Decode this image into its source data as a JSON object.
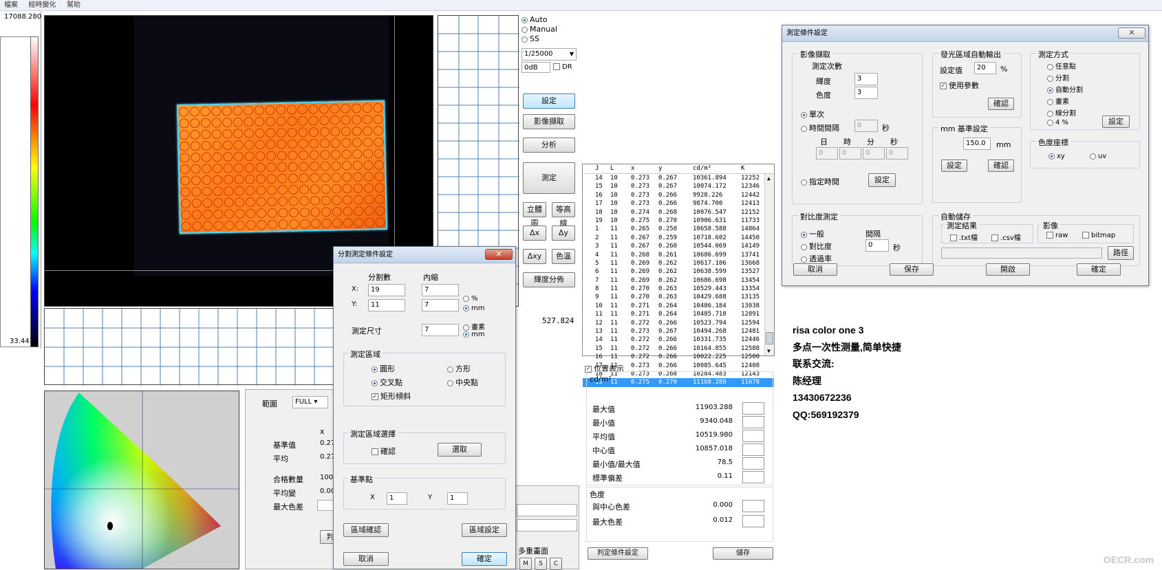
{
  "menu": [
    "檔案",
    "經時變化",
    "幫助"
  ],
  "colorbar": {
    "max": "17088.280",
    "min": "33.441"
  },
  "mode": {
    "auto": "Auto",
    "manual": "Manual",
    "ss": "SS",
    "shutter": "1/25000",
    "gain": "0dB",
    "dr": "DR"
  },
  "buttons": {
    "setting": "設定",
    "capture": "影像擷取",
    "analyze": "分析",
    "measure": "測定",
    "stereo": "立體圖",
    "contour": "等高線",
    "dx": "Δx",
    "dy": "Δy",
    "dxy": "Δxy",
    "color": "色溫",
    "lum_dist": "輝度分佈",
    "judge": "判定條件設定",
    "save": "儲存",
    "multi": "多重畫面",
    "m": "M",
    "s": "S",
    "c": "C"
  },
  "readout": "527.824",
  "list": {
    "headers": [
      "J",
      "L",
      "x",
      "y",
      "cd/m²",
      "K"
    ],
    "rows": [
      [
        "14",
        "10",
        "0.273",
        "0.267",
        "10361.894",
        "12252"
      ],
      [
        "15",
        "10",
        "0.273",
        "0.267",
        "10074.172",
        "12346"
      ],
      [
        "16",
        "10",
        "0.273",
        "0.266",
        "9928.226",
        "12442"
      ],
      [
        "17",
        "10",
        "0.273",
        "0.266",
        "9874.700",
        "12413"
      ],
      [
        "18",
        "10",
        "0.274",
        "0.268",
        "10076.547",
        "12152"
      ],
      [
        "19",
        "10",
        "0.275",
        "0.270",
        "10906.631",
        "11733"
      ],
      [
        "1",
        "11",
        "0.265",
        "0.258",
        "10658.588",
        "14864"
      ],
      [
        "2",
        "11",
        "0.267",
        "0.259",
        "10718.602",
        "14450"
      ],
      [
        "3",
        "11",
        "0.267",
        "0.260",
        "10544.069",
        "14149"
      ],
      [
        "4",
        "11",
        "0.268",
        "0.261",
        "10686.699",
        "13741"
      ],
      [
        "5",
        "11",
        "0.269",
        "0.262",
        "10617.106",
        "13668"
      ],
      [
        "6",
        "11",
        "0.269",
        "0.262",
        "10638.599",
        "13527"
      ],
      [
        "7",
        "11",
        "0.269",
        "0.262",
        "10686.698",
        "13454"
      ],
      [
        "8",
        "11",
        "0.270",
        "0.263",
        "10529.443",
        "13354"
      ],
      [
        "9",
        "11",
        "0.270",
        "0.263",
        "10429.688",
        "13135"
      ],
      [
        "10",
        "11",
        "0.271",
        "0.264",
        "10486.184",
        "13038"
      ],
      [
        "11",
        "11",
        "0.271",
        "0.264",
        "10485.718",
        "12891"
      ],
      [
        "12",
        "11",
        "0.272",
        "0.266",
        "10523.794",
        "12594"
      ],
      [
        "13",
        "11",
        "0.273",
        "0.267",
        "10494.268",
        "12481"
      ],
      [
        "14",
        "11",
        "0.272",
        "0.266",
        "10331.735",
        "12446"
      ],
      [
        "15",
        "11",
        "0.272",
        "0.266",
        "10164.855",
        "12588"
      ],
      [
        "16",
        "11",
        "0.272",
        "0.266",
        "10022.225",
        "12500"
      ],
      [
        "17",
        "11",
        "0.273",
        "0.266",
        "10085.645",
        "12408"
      ],
      [
        "18",
        "11",
        "0.273",
        "0.268",
        "10284.483",
        "12143"
      ],
      [
        "19",
        "11",
        "0.275",
        "0.270",
        "11168.288",
        "11678"
      ]
    ]
  },
  "position_display": "位置表示",
  "stats": {
    "unit": "cd/m²",
    "rows": [
      {
        "label": "最大值",
        "value": "11903.288"
      },
      {
        "label": "最小值",
        "value": "9340.048"
      },
      {
        "label": "平均值",
        "value": "10519.980"
      },
      {
        "label": "中心值",
        "value": "10857.018"
      },
      {
        "label": "最小值/最大值",
        "value": "78.5"
      },
      {
        "label": "標準偏差",
        "value": "0.11"
      }
    ],
    "chroma_title": "色度",
    "chroma_rows": [
      {
        "label": "與中心色差",
        "value": "0.000"
      },
      {
        "label": "最大色差",
        "value": "0.012"
      }
    ]
  },
  "range_panel": {
    "range_label": "範圍",
    "range_value": "FULL",
    "x_header": "x",
    "rows": [
      "基準值",
      "平均",
      "合格數量",
      "平均變",
      "最大色差"
    ],
    "vals": [
      "0.27",
      "0.27",
      "100",
      "0.00",
      ""
    ],
    "btn": "判"
  },
  "split_dialog": {
    "title": "分割測定條件設定",
    "col1": "分割數",
    "col2": "內縮",
    "x_label": "X:",
    "y_label": "Y:",
    "x_div": "19",
    "y_div": "11",
    "x_shrink": "7",
    "y_shrink": "7",
    "pct": "%",
    "mm": "mm",
    "size_label": "測定尺寸",
    "size_val": "7",
    "pixel": "畫素",
    "mm2": "mm",
    "area_title": "測定區域",
    "circle": "圓形",
    "square": "方形",
    "cross": "交叉點",
    "center": "中央點",
    "rect_tilt": "矩形傾斜",
    "select_title": "測定區域選擇",
    "confirm": "確認",
    "pick": "選取",
    "base_title": "基準點",
    "bx_label": "X",
    "bx": "1",
    "by_label": "Y",
    "by": "1",
    "area_confirm": "區域確認",
    "area_set": "區域設定",
    "cancel": "取消",
    "ok": "確定"
  },
  "cond_dialog": {
    "title": "測定條件設定",
    "capture_title": "影像擷取",
    "count_label": "測定次數",
    "lum_label": "輝度",
    "lum_val": "3",
    "chr_label": "色度",
    "chr_val": "3",
    "once": "單次",
    "interval": "時間間隔",
    "interval_val": "0",
    "sec": "秒",
    "day": "日",
    "hour": "時",
    "min": "分",
    "sec2": "秒",
    "d": "0",
    "h": "0",
    "m": "0",
    "s": "0",
    "spec_time": "指定時間",
    "set": "設定",
    "auto_title": "發光區域自動輸出",
    "set_val_label": "設定值",
    "set_val": "20",
    "pct": "%",
    "use_param": "使用參數",
    "confirm": "確認",
    "mm_title": "mm 基準設定",
    "mm_val": "150.0",
    "mm_unit": "mm",
    "set2": "設定",
    "confirm2": "確認",
    "method_title": "測定方式",
    "any_point": "任意點",
    "split": "分割",
    "auto_split": "自動分割",
    "pixel": "畫素",
    "line_split": "線分割",
    "ratio": "4 %",
    "set3": "設定",
    "coord_title": "色度座標",
    "xy": "xy",
    "uv": "uv",
    "contrast_title": "對比度測定",
    "normal": "一般",
    "contrast": "對比度",
    "transmit": "透過率",
    "gap_label": "間隔",
    "gap_val": "0",
    "gap_unit": "秒",
    "autosave_title": "自動儲存",
    "result_title": "測定結果",
    "txt": ".txt檔",
    "csv": ".csv檔",
    "image_title": "影像",
    "raw": "raw",
    "bitmap": "bitmap",
    "browse": "路徑",
    "cancel": "取消",
    "save": "保存",
    "open": "開啟",
    "ok": "確定"
  },
  "info": [
    "risa color one 3",
    "多点一次性测量,简单快捷",
    "联系交流:",
    "陈经理",
    "13430672236",
    "QQ:569192379"
  ],
  "watermark": "OECR.com"
}
